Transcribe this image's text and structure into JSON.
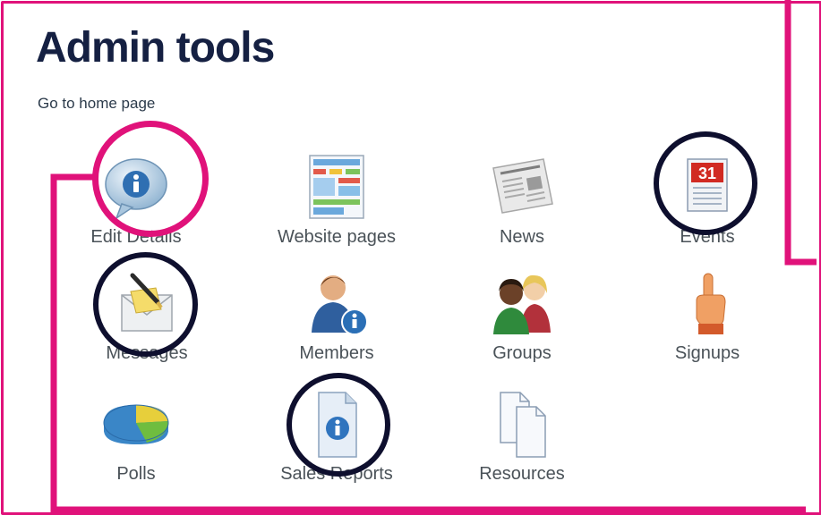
{
  "page": {
    "title": "Admin tools",
    "home_link": "Go to home page"
  },
  "tools": [
    {
      "label": "Edit Details",
      "icon": "info-bubble-icon"
    },
    {
      "label": "Website pages",
      "icon": "website-pages-icon"
    },
    {
      "label": "News",
      "icon": "newspaper-icon"
    },
    {
      "label": "Events",
      "icon": "calendar-icon"
    },
    {
      "label": "Messages",
      "icon": "envelope-icon"
    },
    {
      "label": "Members",
      "icon": "member-info-icon"
    },
    {
      "label": "Groups",
      "icon": "group-people-icon"
    },
    {
      "label": "Signups",
      "icon": "hand-pointer-icon"
    },
    {
      "label": "Polls",
      "icon": "pie-chart-icon"
    },
    {
      "label": "Sales Reports",
      "icon": "report-document-icon"
    },
    {
      "label": "Resources",
      "icon": "documents-icon"
    }
  ],
  "calendar": {
    "day": "31"
  },
  "colors": {
    "highlight_pink": "#e0127a",
    "highlight_navy": "#0e0f2e",
    "title": "#152042"
  }
}
